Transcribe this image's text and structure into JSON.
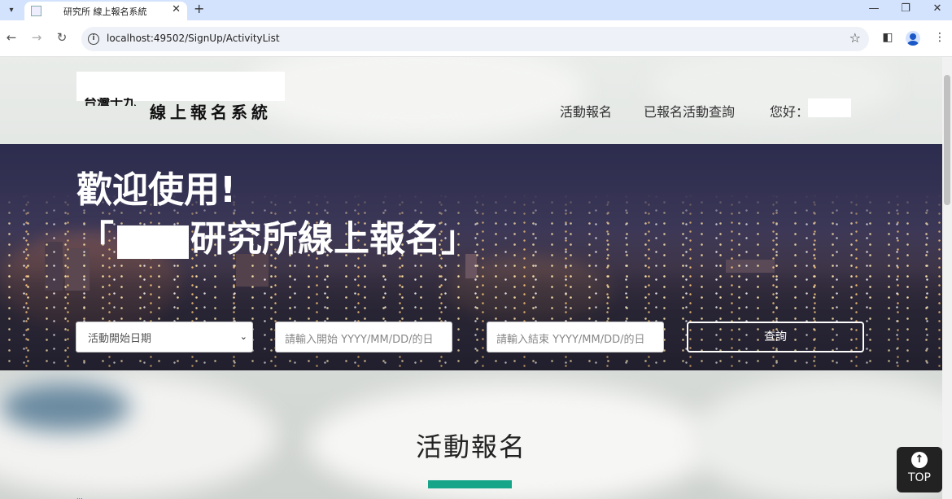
{
  "browser": {
    "tab_title": "研究所 線上報名系統",
    "url": "localhost:49502/SignUp/ActivityList",
    "new_tab": "+",
    "close": "✕"
  },
  "header": {
    "logo_text": "線上報名系統",
    "logo_fragment": "台灣十九",
    "nav": [
      {
        "label": "活動報名"
      },
      {
        "label": "已報名活動查詢"
      },
      {
        "label": "您好："
      }
    ]
  },
  "hero": {
    "title_line1": "歡迎使用!",
    "title_line2_open": "「",
    "title_line2_rest": "研究所線上報名」",
    "search": {
      "date_type_selected": "活動開始日期",
      "start_placeholder": "請輸入開始 YYYY/MM/DD/的日",
      "end_placeholder": "請輸入結束 YYYY/MM/DD/的日",
      "query_label": "查詢"
    }
  },
  "section": {
    "title": "活動報名",
    "accent_color": "#17a589",
    "dots": "..."
  },
  "top_button": {
    "label": "TOP",
    "arrow": "↑"
  }
}
